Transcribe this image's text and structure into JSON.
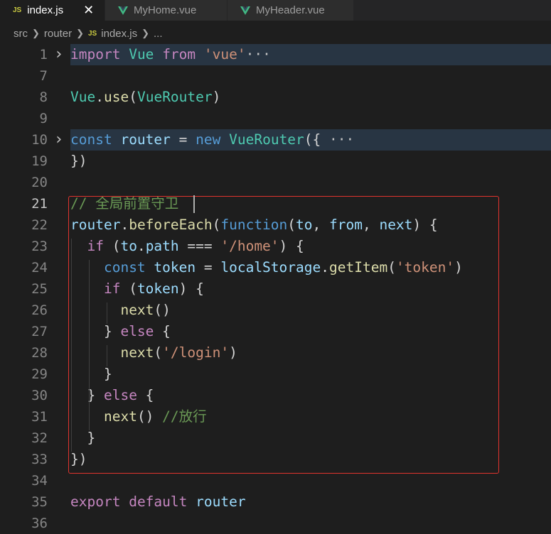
{
  "tabs": [
    {
      "badge": "JS",
      "label": "index.js",
      "close": "✕",
      "active": true
    },
    {
      "label": "MyHome.vue",
      "active": false
    },
    {
      "label": "MyHeader.vue",
      "active": false
    }
  ],
  "breadcrumb": {
    "items": [
      "src",
      "router"
    ],
    "file_badge": "JS",
    "file": "index.js",
    "tail": "..."
  },
  "lines": [
    {
      "n": "1",
      "fold": true,
      "hl": true,
      "tokens": [
        [
          "kw",
          "import"
        ],
        [
          "pn",
          " "
        ],
        [
          "cl",
          "Vue"
        ],
        [
          "pn",
          " "
        ],
        [
          "kw",
          "from"
        ],
        [
          "pn",
          " "
        ],
        [
          "str",
          "'vue'"
        ],
        [
          "ell",
          "···"
        ]
      ]
    },
    {
      "n": "7",
      "tokens": []
    },
    {
      "n": "8",
      "tokens": [
        [
          "cl",
          "Vue"
        ],
        [
          "pn",
          "."
        ],
        [
          "fn",
          "use"
        ],
        [
          "pn",
          "("
        ],
        [
          "cl",
          "VueRouter"
        ],
        [
          "pn",
          ")"
        ]
      ]
    },
    {
      "n": "9",
      "tokens": []
    },
    {
      "n": "10",
      "fold": true,
      "hl": true,
      "tokens": [
        [
          "st",
          "const"
        ],
        [
          "pn",
          " "
        ],
        [
          "vr",
          "router"
        ],
        [
          "pn",
          " = "
        ],
        [
          "st",
          "new"
        ],
        [
          "pn",
          " "
        ],
        [
          "cl",
          "VueRouter"
        ],
        [
          "pn",
          "({"
        ],
        [
          "ell",
          " ···"
        ]
      ]
    },
    {
      "n": "19",
      "tokens": [
        [
          "pn",
          "})"
        ]
      ]
    },
    {
      "n": "20",
      "tokens": []
    },
    {
      "n": "21",
      "current": true,
      "tokens": [
        [
          "cm",
          "// 全局前置守卫"
        ]
      ]
    },
    {
      "n": "22",
      "tokens": [
        [
          "vr",
          "router"
        ],
        [
          "pn",
          "."
        ],
        [
          "fn",
          "beforeEach"
        ],
        [
          "pn",
          "("
        ],
        [
          "st",
          "function"
        ],
        [
          "pn",
          "("
        ],
        [
          "vr",
          "to"
        ],
        [
          "pn",
          ", "
        ],
        [
          "vr",
          "from"
        ],
        [
          "pn",
          ", "
        ],
        [
          "vr",
          "next"
        ],
        [
          "pn",
          ") {"
        ]
      ]
    },
    {
      "n": "23",
      "tokens": [
        [
          "pn",
          "  "
        ],
        [
          "kw",
          "if"
        ],
        [
          "pn",
          " ("
        ],
        [
          "vr",
          "to"
        ],
        [
          "pn",
          "."
        ],
        [
          "vr",
          "path"
        ],
        [
          "pn",
          " === "
        ],
        [
          "str",
          "'/home'"
        ],
        [
          "pn",
          ") {"
        ]
      ]
    },
    {
      "n": "24",
      "tokens": [
        [
          "pn",
          "    "
        ],
        [
          "st",
          "const"
        ],
        [
          "pn",
          " "
        ],
        [
          "vr",
          "token"
        ],
        [
          "pn",
          " = "
        ],
        [
          "vr",
          "localStorage"
        ],
        [
          "pn",
          "."
        ],
        [
          "fn",
          "getItem"
        ],
        [
          "pn",
          "("
        ],
        [
          "str",
          "'token'"
        ],
        [
          "pn",
          ")"
        ]
      ]
    },
    {
      "n": "25",
      "tokens": [
        [
          "pn",
          "    "
        ],
        [
          "kw",
          "if"
        ],
        [
          "pn",
          " ("
        ],
        [
          "vr",
          "token"
        ],
        [
          "pn",
          ") {"
        ]
      ]
    },
    {
      "n": "26",
      "tokens": [
        [
          "pn",
          "      "
        ],
        [
          "fn",
          "next"
        ],
        [
          "pn",
          "()"
        ]
      ]
    },
    {
      "n": "27",
      "tokens": [
        [
          "pn",
          "    } "
        ],
        [
          "kw",
          "else"
        ],
        [
          "pn",
          " {"
        ]
      ]
    },
    {
      "n": "28",
      "tokens": [
        [
          "pn",
          "      "
        ],
        [
          "fn",
          "next"
        ],
        [
          "pn",
          "("
        ],
        [
          "str",
          "'/login'"
        ],
        [
          "pn",
          ")"
        ]
      ]
    },
    {
      "n": "29",
      "tokens": [
        [
          "pn",
          "    }"
        ]
      ]
    },
    {
      "n": "30",
      "tokens": [
        [
          "pn",
          "  } "
        ],
        [
          "kw",
          "else"
        ],
        [
          "pn",
          " {"
        ]
      ]
    },
    {
      "n": "31",
      "tokens": [
        [
          "pn",
          "    "
        ],
        [
          "fn",
          "next"
        ],
        [
          "pn",
          "() "
        ],
        [
          "cm",
          "//放行"
        ]
      ]
    },
    {
      "n": "32",
      "tokens": [
        [
          "pn",
          "  }"
        ]
      ]
    },
    {
      "n": "33",
      "tokens": [
        [
          "pn",
          "})"
        ]
      ]
    },
    {
      "n": "34",
      "tokens": []
    },
    {
      "n": "35",
      "tokens": [
        [
          "kw",
          "export"
        ],
        [
          "pn",
          " "
        ],
        [
          "kw",
          "default"
        ],
        [
          "pn",
          " "
        ],
        [
          "vr",
          "router"
        ]
      ]
    },
    {
      "n": "36",
      "tokens": []
    }
  ],
  "colors": {
    "keyword": "#c586c0",
    "storage": "#569cd6",
    "variable": "#9cdcfe",
    "function": "#dcdcaa",
    "class": "#4ec9b0",
    "string": "#ce9178",
    "comment": "#6a9955",
    "highlight_box": "#e0342e"
  }
}
